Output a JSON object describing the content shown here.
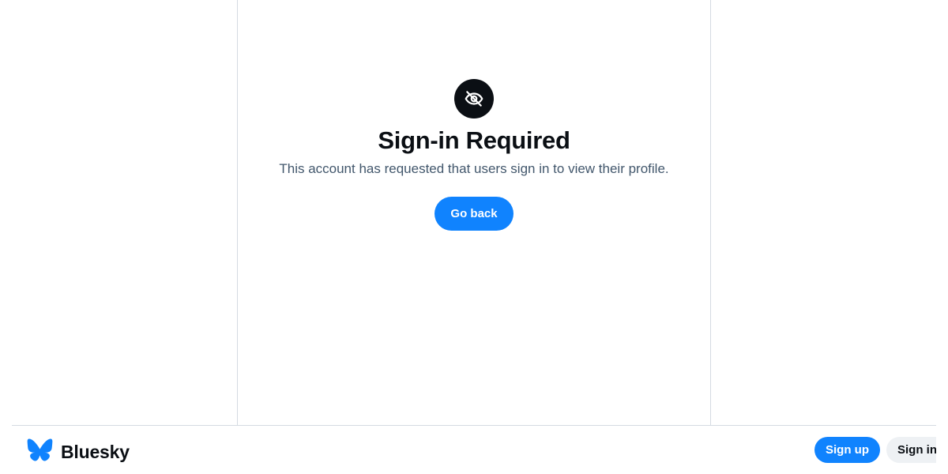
{
  "notice": {
    "icon": "eye-slash-icon",
    "title": "Sign-in Required",
    "message": "This account has requested that users sign in to view their profile.",
    "go_back_label": "Go back"
  },
  "bottom_bar": {
    "brand_icon": "butterfly-logo-icon",
    "brand_name": "Bluesky",
    "signup_label": "Sign up",
    "signin_label": "Sign in"
  },
  "colors": {
    "accent": "#1083fe",
    "text": "#0b0f14",
    "muted_text": "#42576c",
    "border": "#d4dbe2"
  }
}
